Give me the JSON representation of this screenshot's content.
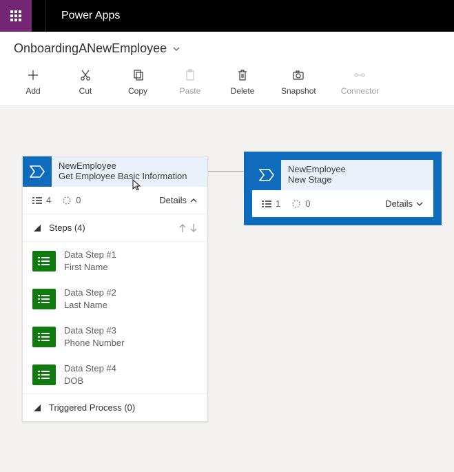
{
  "app_title": "Power Apps",
  "process_name": "OnboardingANewEmployee",
  "toolbar": {
    "add": "Add",
    "cut": "Cut",
    "copy": "Copy",
    "paste": "Paste",
    "delete": "Delete",
    "snapshot": "Snapshot",
    "connector": "Connector"
  },
  "stage_a": {
    "entity": "NewEmployee",
    "name": "Get Employee Basic Information",
    "step_count": "4",
    "process_count": "0",
    "details": "Details",
    "steps_header": "Steps (4)",
    "steps": [
      {
        "title": "Data Step #1",
        "field": "First Name"
      },
      {
        "title": "Data Step #2",
        "field": "Last Name"
      },
      {
        "title": "Data Step #3",
        "field": "Phone Number"
      },
      {
        "title": "Data Step #4",
        "field": "DOB"
      }
    ],
    "triggered": "Triggered Process (0)"
  },
  "stage_b": {
    "entity": "NewEmployee",
    "name": "New Stage",
    "step_count": "1",
    "process_count": "0",
    "details": "Details"
  }
}
